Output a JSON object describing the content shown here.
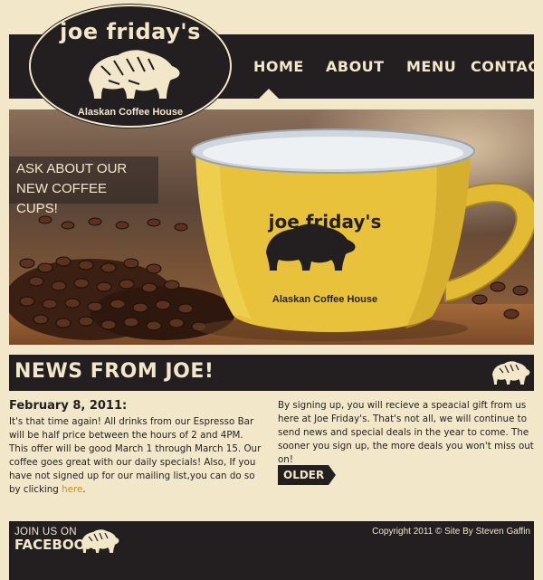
{
  "logo": {
    "title": "joe friday's",
    "subtitle": "Alaskan Coffee House",
    "bear_icon": "bear-icon"
  },
  "nav": {
    "items": [
      {
        "label": "HOME",
        "active": true
      },
      {
        "label": "ABOUT",
        "active": false
      },
      {
        "label": "MENU",
        "active": false
      },
      {
        "label": "CONTACT",
        "active": false
      }
    ]
  },
  "hero": {
    "caption_line1": "ASK ABOUT OUR",
    "caption_line2": "NEW COFFEE CUPS!",
    "cup_title": "joe friday's",
    "cup_subtitle": "Alaskan Coffee House"
  },
  "news": {
    "title": "NEWS FROM JOE!",
    "post_date": "February 8, 2011:",
    "post_body": "It's that time again! All drinks from our Espresso Bar will be half price between the hours of 2 and 4PM. This offer will be good March 1 through March 15. Our coffee goes great with our daily specials! Also, If you have not signed up for our mailing list,you can do so by clicking ",
    "post_link": "here",
    "post_end": ".",
    "right_body": "By signing up, you will recieve a speacial gift from us here at Joe Friday's. That's not all, we will continue to send news and special deals in the year to come. The sooner you sign up, the more deals you won't miss out on!",
    "older_label": "OLDER"
  },
  "footer": {
    "join_label": "JOIN US ON",
    "facebook_label": "FACEBOOK",
    "copyright": "Copyright 2011 © Site By Steven Gaffin"
  },
  "colors": {
    "background": "#f3e7c9",
    "dark": "#231f20",
    "cream": "#f3e7c9",
    "link": "#c8902c",
    "cup_yellow": "#e8c23a"
  }
}
